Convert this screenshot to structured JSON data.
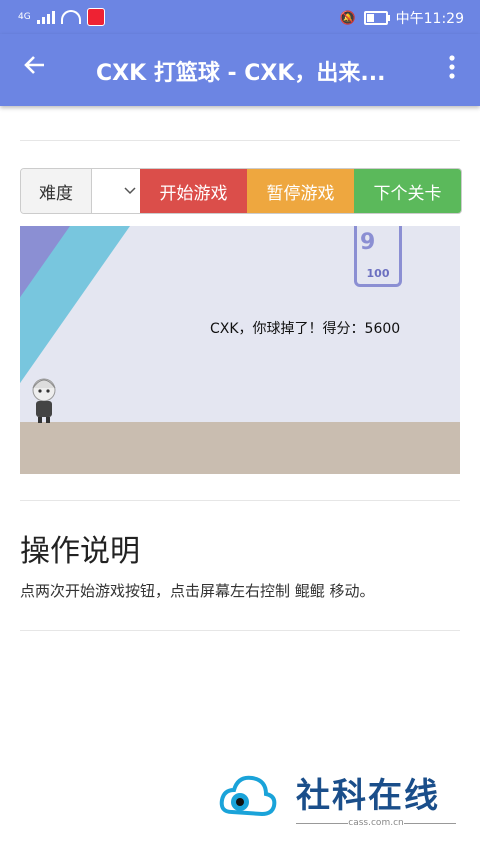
{
  "status": {
    "network": "4G",
    "time": "中午11:29"
  },
  "appbar": {
    "title": "CXK 打篮球 - CXK，出来...",
    "back_icon": "arrow-left-icon",
    "more_icon": "more-vertical-icon"
  },
  "controls": {
    "difficulty_label": "难度",
    "difficulty_value": "",
    "start_label": "开始游戏",
    "pause_label": "暂停游戏",
    "next_label": "下个关卡",
    "colors": {
      "start": "#db4e4a",
      "pause": "#eea73f",
      "next": "#5bb95b"
    }
  },
  "game": {
    "hoop_number": "9",
    "hoop_score": "100",
    "message": "CXK，你球掉了！得分：5600"
  },
  "instructions": {
    "title": "操作说明",
    "text": "点两次开始游戏按钮，点击屏幕左右控制 鲲鲲 移动。"
  },
  "watermark": {
    "brand": "社科在线",
    "url": "cass.com.cn"
  },
  "colors": {
    "appbar": "#6c85e3"
  }
}
